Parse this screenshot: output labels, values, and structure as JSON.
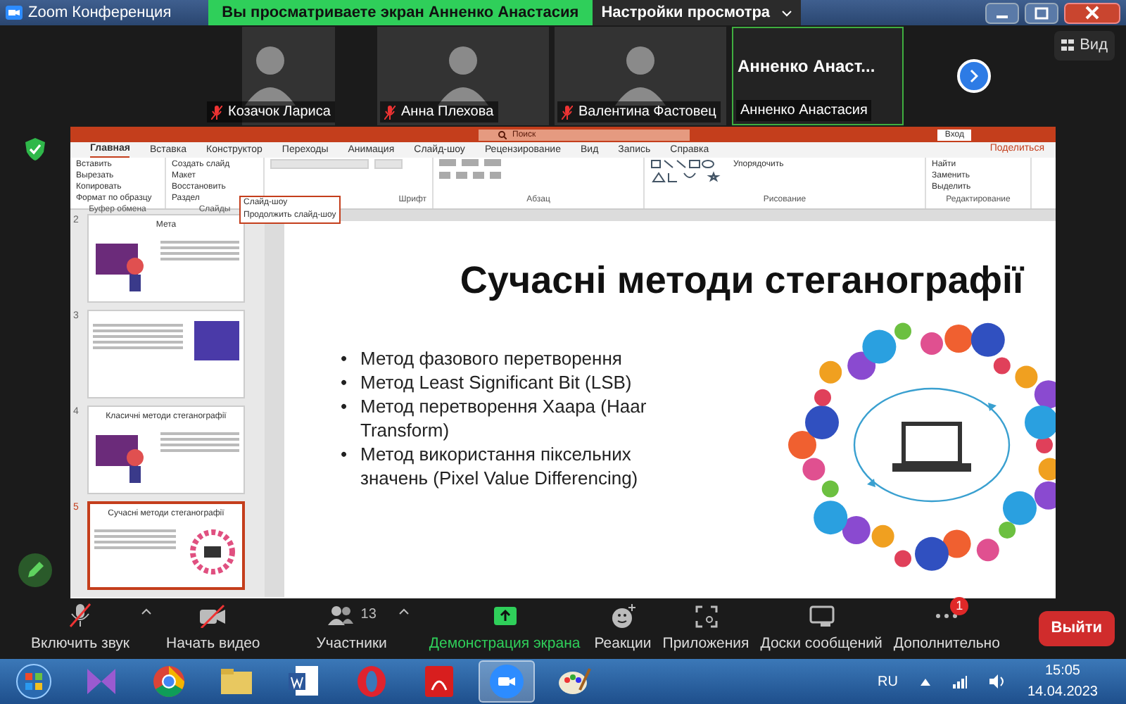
{
  "zoom_window": {
    "title": "Zoom Конференция",
    "share_banner": "Вы просматриваете экран Анненко Анастасия",
    "view_settings": "Настройки просмотра",
    "view_button": "Вид"
  },
  "participants": [
    {
      "name": "Козачок Лариса",
      "kind": "video",
      "muted": true,
      "speaking": false
    },
    {
      "name": "Анна Плехова",
      "kind": "video",
      "muted": true,
      "speaking": false
    },
    {
      "name": "Валентина Фастовец",
      "kind": "video",
      "muted": true,
      "speaking": false
    },
    {
      "name": "Анненко Анастасия",
      "kind": "name",
      "display": "Анненко  Анаст...",
      "muted": false,
      "speaking": true
    }
  ],
  "powerpoint": {
    "search": "Поиск",
    "sign_in": "Вход",
    "share": "Поделиться",
    "tabs": [
      {
        "label": "Главная",
        "selected": true
      },
      {
        "label": "Вставка",
        "selected": false
      },
      {
        "label": "Конструктор",
        "selected": false
      },
      {
        "label": "Переходы",
        "selected": false
      },
      {
        "label": "Анимация",
        "selected": false
      },
      {
        "label": "Слайд-шоу",
        "selected": false
      },
      {
        "label": "Рецензирование",
        "selected": false
      },
      {
        "label": "Вид",
        "selected": false
      },
      {
        "label": "Запись",
        "selected": false
      },
      {
        "label": "Справка",
        "selected": false
      }
    ],
    "groups": [
      {
        "label": "Буфер обмена",
        "kind": "clipboard",
        "buttons": [
          "Вставить",
          "Вырезать",
          "Копировать",
          "Формат по образцу"
        ]
      },
      {
        "label": "Слайды",
        "kind": "slides",
        "buttons": [
          "Создать слайд",
          "Макет",
          "Восстановить",
          "Раздел"
        ]
      },
      {
        "label": "Шрифт",
        "kind": "font"
      },
      {
        "label": "Абзац",
        "kind": "paragraph"
      },
      {
        "label": "Рисование",
        "kind": "drawing",
        "buttons": [
          "Упорядочить"
        ]
      },
      {
        "label": "Редактирование",
        "kind": "editing",
        "buttons": [
          "Найти",
          "Заменить",
          "Выделить"
        ]
      }
    ],
    "popup": {
      "title": "Слайд-шоу",
      "item": "Продолжить слайд-шоу"
    },
    "thumbnails": [
      {
        "number": "2",
        "title": "Мета",
        "kind": "figure",
        "selected": false
      },
      {
        "number": "3",
        "kind": "text",
        "selected": false
      },
      {
        "number": "4",
        "title": "Класичні методи стеганографії",
        "kind": "figure",
        "selected": false
      },
      {
        "number": "5",
        "title": "Сучасні методи стеганографії",
        "kind": "circle",
        "selected": true
      }
    ],
    "slide": {
      "title": "Сучасні методи стеганографії",
      "bullet_marker": "•",
      "bullets": [
        "Метод фазового перетворення",
        "Метод Least Significant Bit (LSB)",
        "Метод перетворення Хаара (Haar Transform)",
        "Метод використання піксельних значень (Pixel Value Differencing)"
      ]
    }
  },
  "toolbar": [
    {
      "label": "Включить звук",
      "kind": "mic",
      "caret": true,
      "active": false
    },
    {
      "label": "Начать видео",
      "kind": "video",
      "caret": false,
      "active": false
    },
    {
      "label": "Участники",
      "kind": "participants",
      "count": "13",
      "caret": true,
      "active": false
    },
    {
      "label": "Демонстрация экрана",
      "kind": "share",
      "caret": false,
      "active": true
    },
    {
      "label": "Реакции",
      "kind": "reactions",
      "caret": false,
      "active": false
    },
    {
      "label": "Приложения",
      "kind": "apps",
      "caret": false,
      "active": false
    },
    {
      "label": "Доски сообщений",
      "kind": "whiteboard",
      "caret": false,
      "active": false
    },
    {
      "label": "Дополнительно",
      "kind": "more",
      "badge": "1",
      "caret": false,
      "active": false
    }
  ],
  "leave_button": "Выйти",
  "taskbar": {
    "apps": [
      {
        "kind": "start",
        "active": false
      },
      {
        "kind": "visual-studio",
        "active": false
      },
      {
        "kind": "chrome",
        "active": false
      },
      {
        "kind": "folder",
        "active": false
      },
      {
        "kind": "word",
        "active": false
      },
      {
        "kind": "opera",
        "active": false
      },
      {
        "kind": "acrobat",
        "active": false
      },
      {
        "kind": "zoom",
        "active": true
      },
      {
        "kind": "paint",
        "active": false
      }
    ],
    "language": "RU",
    "time": "15:05",
    "date": "14.04.2023"
  }
}
